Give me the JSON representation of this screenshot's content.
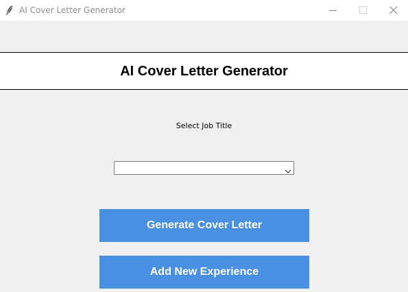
{
  "window": {
    "title": "AI Cover Letter Generator",
    "icon": "feather-icon",
    "controls": {
      "minimize_icon": "minimize-icon",
      "maximize_icon": "maximize-icon",
      "close_icon": "close-icon"
    }
  },
  "header": {
    "title": "AI Cover Letter Generator"
  },
  "form": {
    "job_title_label": "Select Job Title",
    "job_title_value": "",
    "dropdown_icon": "chevron-down-icon"
  },
  "actions": {
    "generate_label": "Generate Cover Letter",
    "add_experience_label": "Add New Experience"
  },
  "colors": {
    "button_bg": "#4a90e2",
    "button_text": "#ffffff",
    "window_bg": "#f0f0f0",
    "header_bg": "#ffffff"
  }
}
